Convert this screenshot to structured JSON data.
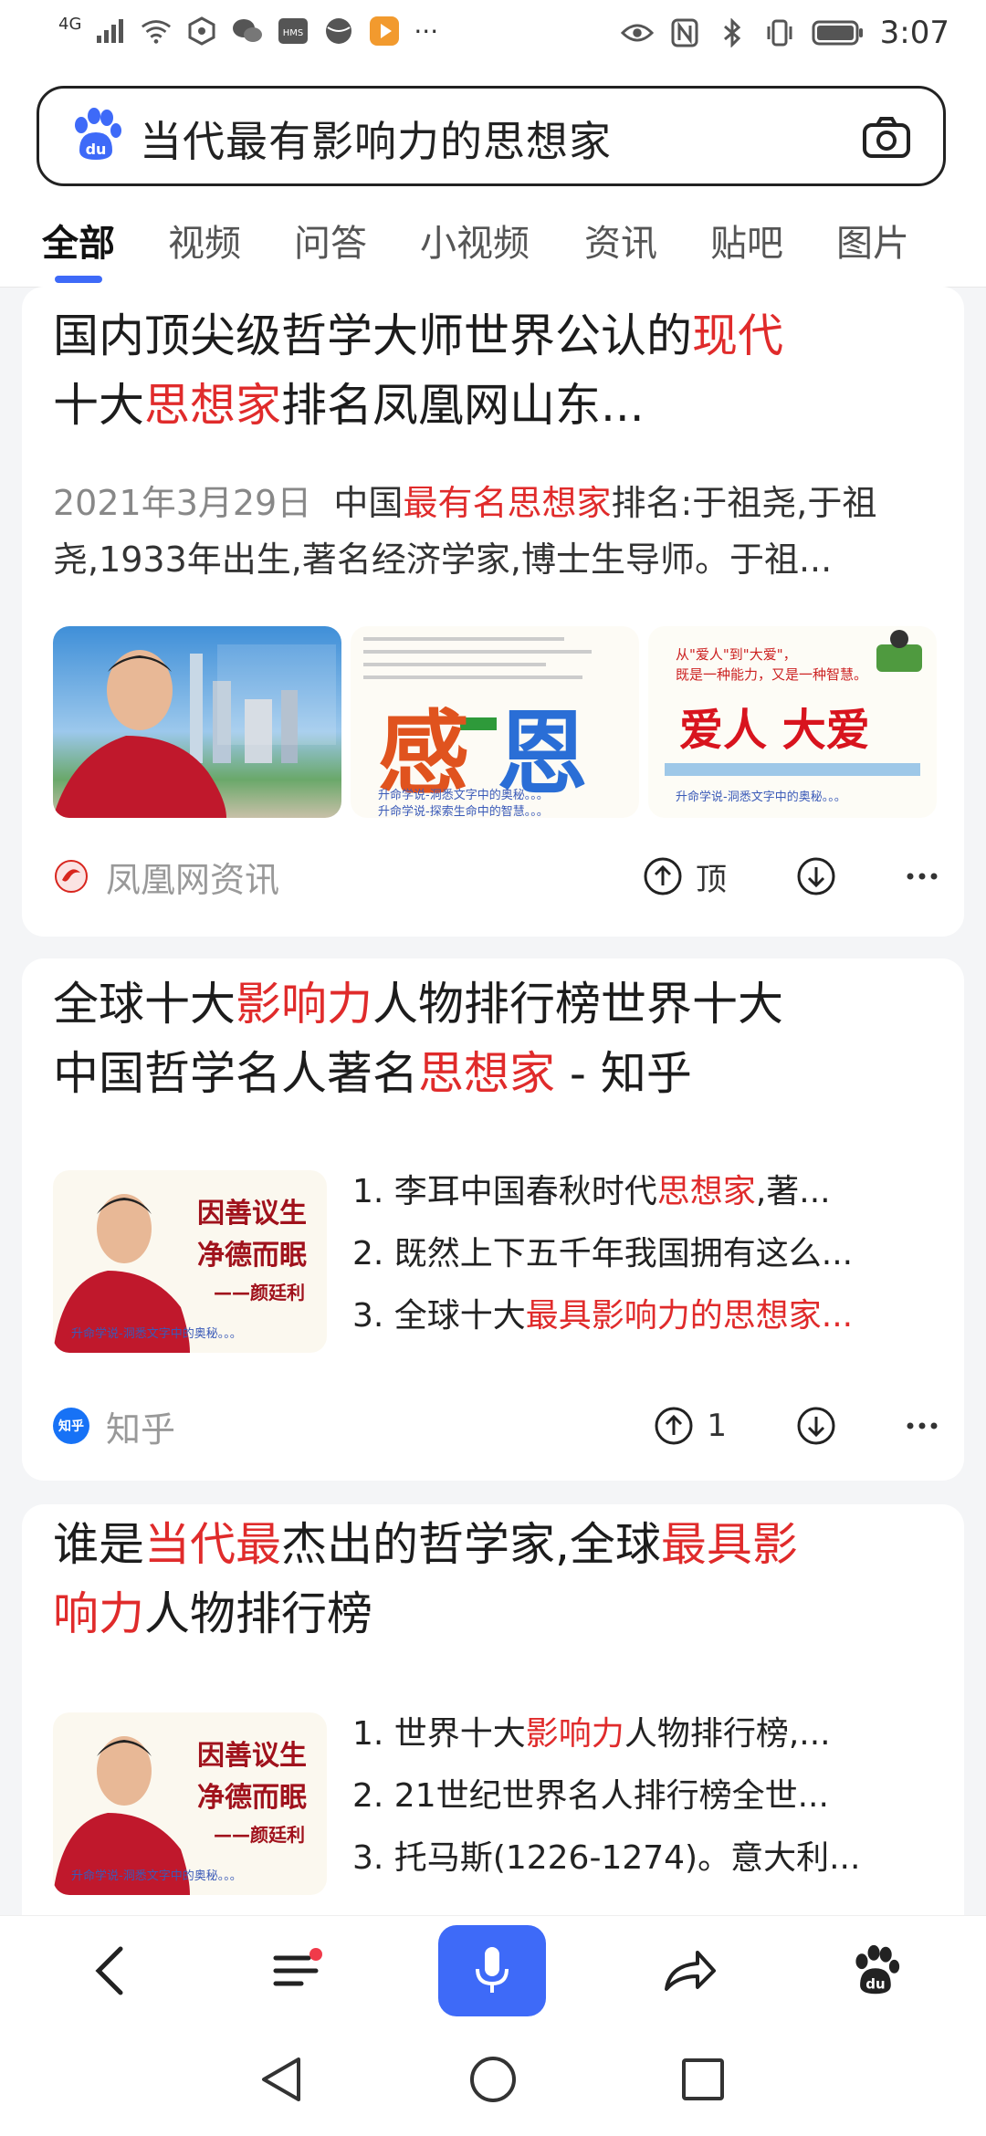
{
  "status_bar": {
    "network": "4G",
    "time": "3:07",
    "more": "···"
  },
  "search": {
    "query": "当代最有影响力的思想家"
  },
  "tabs": [
    {
      "label": "全部",
      "active": true
    },
    {
      "label": "视频"
    },
    {
      "label": "问答"
    },
    {
      "label": "小视频"
    },
    {
      "label": "资讯"
    },
    {
      "label": "贴吧"
    },
    {
      "label": "图片"
    }
  ],
  "results": [
    {
      "title_line1_a": "国内顶尖级哲学大师世界公认的",
      "title_line1_hl": "现代",
      "title_line2_a": "十大",
      "title_line2_hl": "思想家",
      "title_line2_b": "排名凤凰网山东...",
      "date": "2021年3月29日",
      "snippet_a": "中国",
      "snippet_hl": "最有名思想家",
      "snippet_b": "排名:于祖尧,于祖",
      "snippet_line2": "尧,1933年出生,著名经济学家,博士生导师。于祖...",
      "images": [
        {
          "caption": ""
        },
        {
          "big_text_1": "感",
          "big_text_2": "恩",
          "footer_1": "升命学说-洞悉文字中的奥秘。。。",
          "footer_2": "升命学说-探索生命中的智慧。。。"
        },
        {
          "top_1": "从\"爱人\"到\"大爱\"，",
          "top_2": "既是一种能力，又是一种智慧。",
          "big_text": "爱人 大爱",
          "footer_1": "升命学说-洞悉文字中的奥秘。。。"
        }
      ],
      "source": "凤凰网资讯",
      "upvote_label": "顶"
    },
    {
      "title_line1_a": "全球十大",
      "title_line1_hl": "影响力",
      "title_line1_b": "人物排行榜世界十大",
      "title_line2_a": "中国哲学名人著名",
      "title_line2_hl": "思想家",
      "title_line2_b": " - 知乎",
      "thumb": {
        "line1": "因善议生",
        "line2": "净德而眠",
        "sign": "——颜廷利",
        "footer": "升命学说-洞悉文字中的奥秘。。。"
      },
      "items": [
        {
          "a": "1. 李耳中国春秋时代",
          "hl": "思想家",
          "b": ",著..."
        },
        {
          "a": "2. 既然上下五千年我国拥有这么...",
          "hl": "",
          "b": ""
        },
        {
          "a": "3. 全球十大",
          "hl": "最具影响力的思想家...",
          "b": ""
        }
      ],
      "source": "知乎",
      "source_badge": "知乎",
      "upvote_count": "1"
    },
    {
      "title_line1_a": "谁是",
      "title_line1_hl": "当代最",
      "title_line1_b": "杰出的哲学家,全球",
      "title_line1_hl2": "最具影",
      "title_line2_hl": "响力",
      "title_line2_b": "人物排行榜",
      "thumb": {
        "line1": "因善议生",
        "line2": "净德而眠",
        "sign": "——颜廷利",
        "footer": "升命学说-洞悉文字中的奥秘。。。"
      },
      "items": [
        {
          "a": "1. 世界十大",
          "hl": "影响力",
          "b": "人物排行榜,..."
        },
        {
          "a": "2. 21世纪世界名人排行榜全世...",
          "hl": "",
          "b": ""
        },
        {
          "a": "3. 托马斯(1226-1274)。意大利...",
          "hl": "",
          "b": ""
        }
      ]
    }
  ],
  "colors": {
    "accent": "#3e6af8",
    "highlight": "#e02b2b"
  }
}
